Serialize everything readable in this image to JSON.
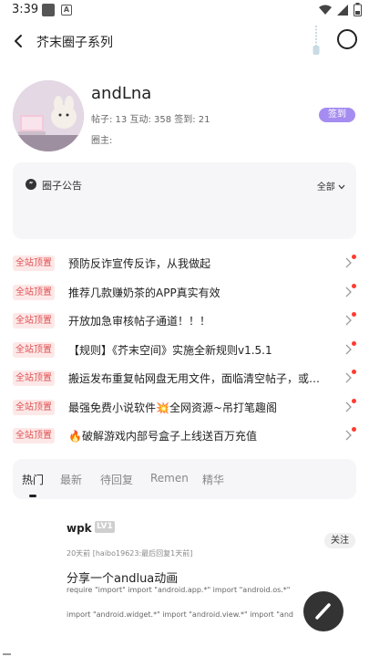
{
  "status_bar": {
    "time": "3:39",
    "notif_a_letter": "A"
  },
  "app_bar": {
    "title": "芥末圈子系列"
  },
  "profile": {
    "username": "andLna",
    "stats": "帖子: 13 互动: 358 签到: 21",
    "circle_owner": "圈主:",
    "checkin_label": "签到"
  },
  "notice": {
    "title": "圈子公告",
    "all_label": "全部"
  },
  "pinned": {
    "badge": "全站顶置",
    "items": [
      "预防反诈宣传反诈，从我做起",
      "推荐几款赚奶茶的APP真实有效",
      "开放加急审核帖子通道！！！",
      "【规则】《芥末空间》实施全新规则v1.5.1",
      "搬运发布重复帖网盘无用文件，面临清空帖子，或…",
      "最强免费小说软件💥全网资源~吊打笔趣阁",
      "🔥破解游戏内部号盒子上线送百万充值"
    ]
  },
  "tabs": [
    "热门",
    "最新",
    "待回复",
    "Remen",
    "精华"
  ],
  "post": {
    "author": "wpk",
    "level": "LV1",
    "meta": "20天前 [haibo19623:最后回复1天前]",
    "follow_label": "关注",
    "title": "分享一个andlua动画",
    "snippet1": "require \"import\" import \"android.app.*\" import \"android.os.*\"",
    "snippet2": "import \"android.widget.*\" import \"android.view.*\" import \"and"
  },
  "colors": {
    "accent": "#a58cf0",
    "pin_red": "#e05252",
    "dot_red": "#ff3b30"
  }
}
